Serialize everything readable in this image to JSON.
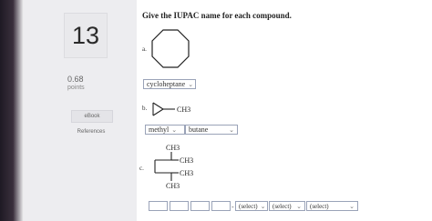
{
  "question": {
    "number": "13",
    "points_value": "0.68",
    "points_label": "points",
    "ebook_label": "eBook",
    "references_label": "References",
    "prompt": "Give the IUPAC name for each compound."
  },
  "part_a": {
    "label": "a.",
    "answer": "cycloheptane"
  },
  "part_b": {
    "label": "b.",
    "substituent_label": "CH3",
    "substituent": "methyl",
    "parent": "butane"
  },
  "part_c": {
    "label": "c.",
    "groups": [
      "CH3",
      "CH3",
      "CH3",
      "CH3"
    ],
    "blank_boxes": [
      "",
      "",
      "",
      ""
    ],
    "selects": [
      "(select)",
      "(select)",
      "(select)"
    ]
  },
  "icons": {
    "dropdown": "chevron-down-icon"
  }
}
